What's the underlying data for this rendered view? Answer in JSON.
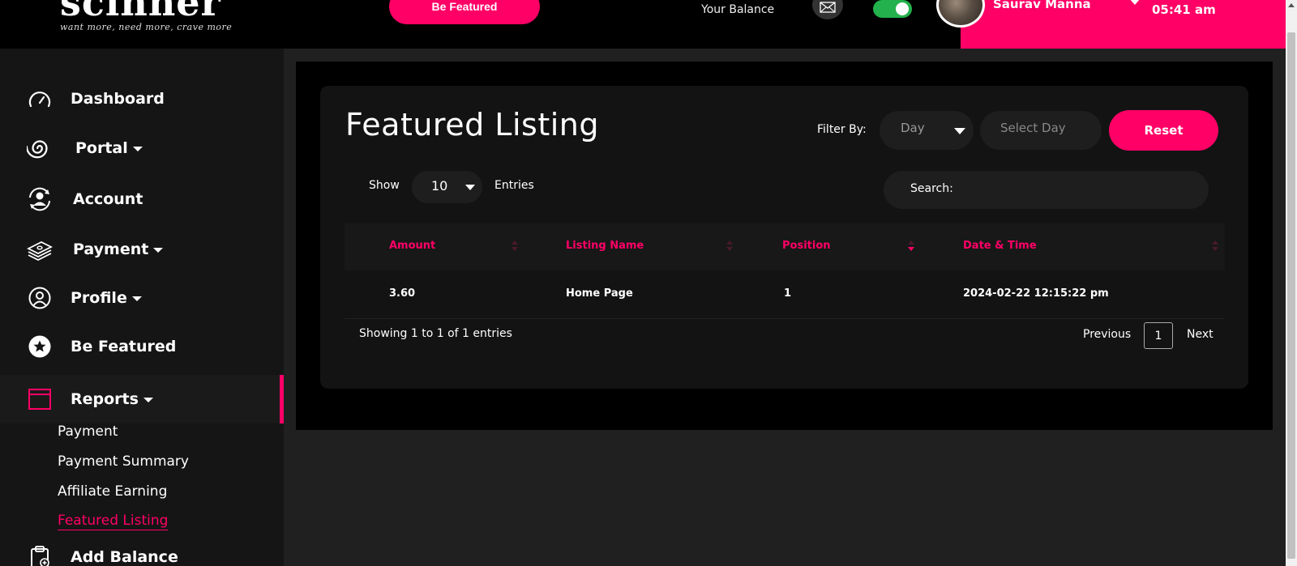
{
  "header": {
    "logo_text": "scinner",
    "logo_tagline": "want more, need more, crave more",
    "featured_button": "Be Featured",
    "balance_label": "Your Balance",
    "user_name": "Saurav Manna",
    "time": "05:41 am",
    "toggle_on": true,
    "accent_color": "#ff0066",
    "toggle_color": "#22b14c"
  },
  "sidebar": {
    "items": [
      {
        "label": "Dashboard",
        "icon": "speedometer-icon"
      },
      {
        "label": "Portal",
        "icon": "spiral-icon"
      },
      {
        "label": "Account",
        "icon": "user-sync-icon"
      },
      {
        "label": "Payment",
        "icon": "money-stack-icon"
      },
      {
        "label": "Profile",
        "icon": "user-circle-icon"
      },
      {
        "label": "Be Featured",
        "icon": "star-badge-icon"
      },
      {
        "label": "Reports",
        "icon": "window-icon"
      },
      {
        "label": "Add Balance",
        "icon": "clipboard-plus-icon"
      }
    ],
    "report_subitems": [
      "Payment",
      "Payment Summary",
      "Affiliate Earning",
      "Featured Listing"
    ]
  },
  "main": {
    "title": "Featured Listing",
    "filter_label": "Filter By:",
    "day_select_value": "Day",
    "select_day_placeholder": "Select Day",
    "reset_label": "Reset",
    "show_label": "Show",
    "entries_value": "10",
    "entries_label": "Entries",
    "search_label": "Search:",
    "search_value": "",
    "columns": [
      "Amount",
      "Listing Name",
      "Position",
      "Date & Time"
    ],
    "rows": [
      [
        "3.60",
        "Home Page",
        "1",
        "2024-02-22 12:15:22 pm"
      ]
    ],
    "showing_info": "Showing 1 to 1 of 1 entries",
    "pagination": {
      "previous": "Previous",
      "current_page": "1",
      "next": "Next"
    }
  }
}
